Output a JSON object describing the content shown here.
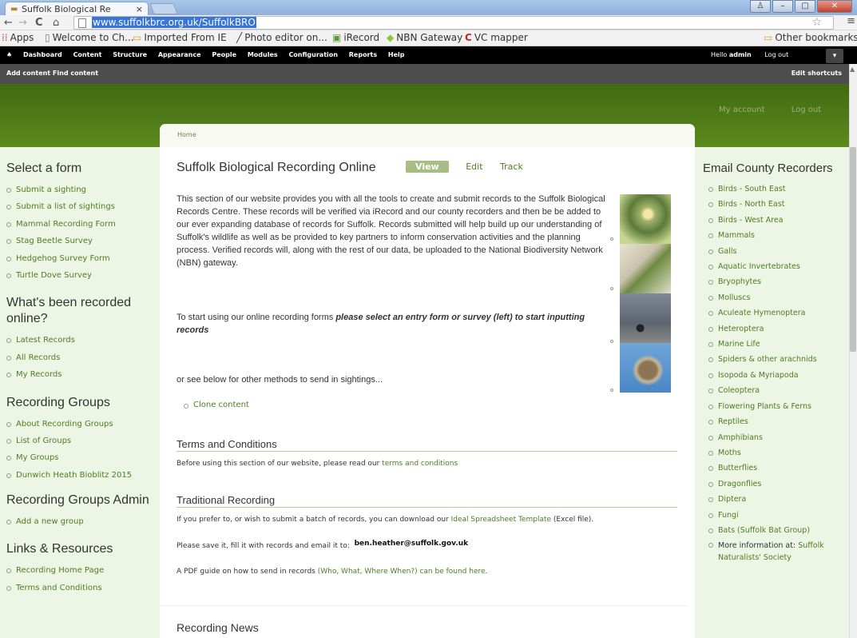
{
  "browser": {
    "tab_title": "Suffolk Biological Re",
    "tab_close": "×",
    "url": "www.suffolkbrc.org.uk/SuffolkBRO",
    "bookmarks": [
      {
        "label": "Apps",
        "icon": "apps-icon"
      },
      {
        "label": "Welcome to Ch...",
        "icon": "page-icon"
      },
      {
        "label": "Imported From IE",
        "icon": "folder-icon"
      },
      {
        "label": "Photo editor on...",
        "icon": "pencil-icon"
      },
      {
        "label": "iRecord",
        "icon": "irecord-icon"
      },
      {
        "label": "NBN Gateway",
        "icon": "leaf-icon"
      },
      {
        "label": "VC mapper",
        "icon": "c-icon"
      }
    ],
    "other_bookmarks": "Other bookmarks"
  },
  "admin": {
    "menu": [
      "Dashboard",
      "Content",
      "Structure",
      "Appearance",
      "People",
      "Modules",
      "Configuration",
      "Reports",
      "Help"
    ],
    "hello_prefix": "Hello ",
    "user": "admin",
    "logout": "Log out",
    "shortcuts": "Add content  Find content",
    "edit_shortcuts": "Edit shortcuts"
  },
  "header": {
    "my_account": "My account",
    "log_out": "Log out"
  },
  "breadcrumb": "Home",
  "page": {
    "title": "Suffolk Biological Recording Online",
    "tabs": [
      "View",
      "Edit",
      "Track"
    ],
    "intro": "This section of our website provides you with all the tools to create and submit records to the Suffolk Biological Records Centre. These records will be verified via iRecord and our county recorders and then be be added to our ever expanding database of records for Suffolk. Records submitted will help build up our understanding of Suffolk's wildlife as well as be provided to key partners to inform conservation activities and the planning process. Verified records will, along with the rest of our data, be uploaded to the National Biodiversity Network (NBN) gateway.",
    "intro2_pre": "To start using our online recording forms ",
    "intro2_em": "please select an entry form or survey (left) to start inputting records",
    "intro3": "or see below for other methods to send in sightings...",
    "clone": "Clone content",
    "terms_title": "Terms and Conditions",
    "terms_pre": "Before using this section of our website, please read our ",
    "terms_link": "terms and conditions",
    "trad_title": "Traditional Recording",
    "trad_pre": "If you prefer to, or wish to submit a batch of records, you can download our ",
    "trad_link": "Ideal Spreadsheet Template",
    "trad_post": " (Excel file).",
    "save_text": "Please save it, fill it with records and email it to:",
    "email": "ben.heather@suffolk.gov.uk",
    "pdf_pre": "A PDF guide on how to send in records ",
    "pdf_link": "(Who, What, Where When?) can be found here",
    "pdf_post": ".",
    "news_title": "Recording News"
  },
  "left": {
    "sections": [
      {
        "title": "Select a form",
        "items": [
          "Submit a sighting",
          "Submit a list of sightings",
          "Mammal Recording Form",
          "Stag Beetle Survey",
          "Hedgehog Survey Form",
          "Turtle Dove Survey"
        ]
      },
      {
        "title": "What's been recorded online?",
        "items": [
          "Latest Records",
          "All Records",
          "My Records"
        ]
      },
      {
        "title": "Recording Groups",
        "items": [
          "About Recording Groups",
          "List of Groups",
          "My Groups",
          "Dunwich Heath Bioblitz 2015"
        ]
      },
      {
        "title": "Recording Groups Admin",
        "items": [
          "Add a new group"
        ]
      },
      {
        "title": "Links & Resources",
        "items": [
          "Recording Home Page",
          "Terms and Conditions"
        ]
      }
    ]
  },
  "right": {
    "title": "Email County Recorders",
    "items": [
      "Birds - South East",
      "Birds - North East",
      "Birds - West Area",
      "Mammals",
      "Galls",
      "Aquatic Invertebrates",
      "Bryophytes",
      "Molluscs",
      "Aculeate Hymenoptera",
      "Heteroptera",
      "Marine Life",
      "Spiders & other arachnids",
      "Isopoda & Myriapoda",
      "Coleoptera",
      "Flowering Plants & Ferns",
      "Reptiles",
      "Amphibians",
      "Moths",
      "Butterflies",
      "Dragonflies",
      "Diptera",
      "Fungi",
      "Bats (Suffolk Bat Group)"
    ],
    "more_pre": "More information at: ",
    "more_link": "Suffolk Naturalists' Society"
  }
}
